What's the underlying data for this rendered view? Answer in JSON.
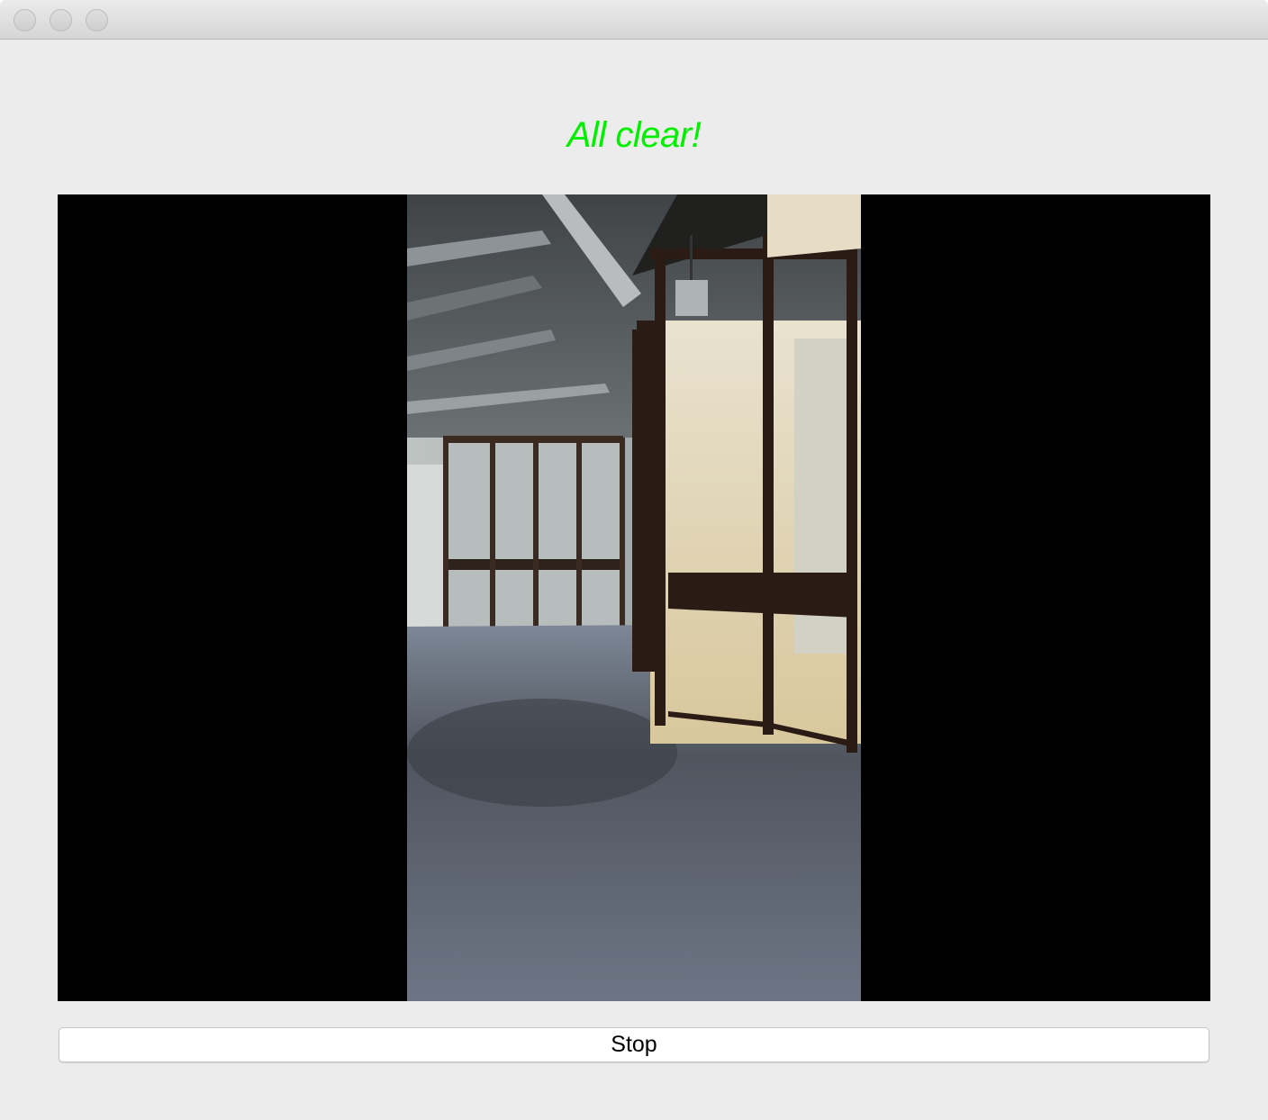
{
  "window": {
    "buttons": [
      "close-button",
      "minimize-button",
      "zoom-button"
    ]
  },
  "status": {
    "text": "All clear!",
    "color": "#00f000"
  },
  "video": {
    "description_icon": "camera-feed"
  },
  "controls": {
    "stop_label": "Stop"
  }
}
